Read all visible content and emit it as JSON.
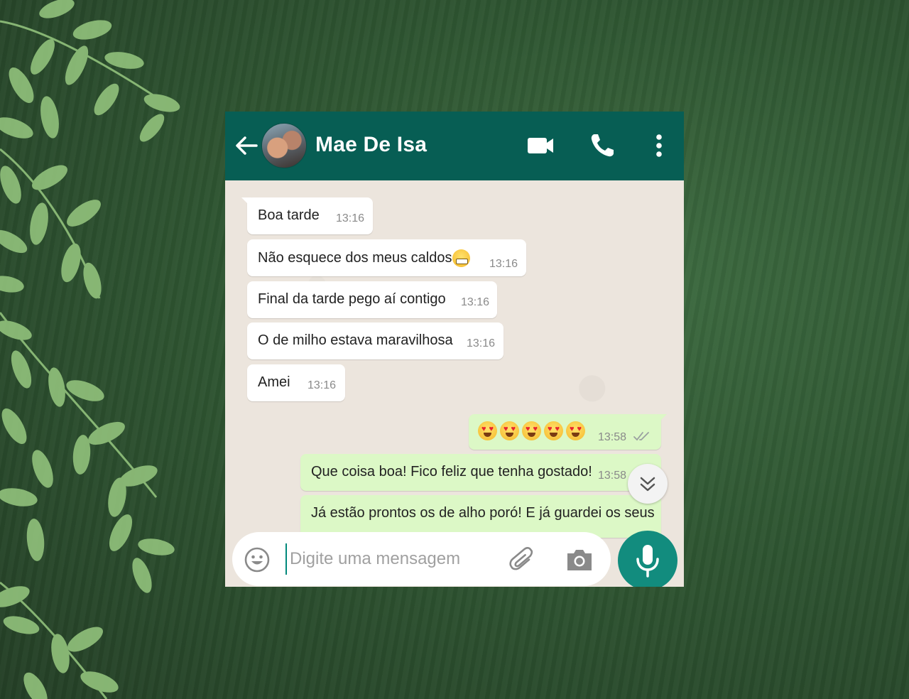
{
  "header": {
    "contact_name": "Mae De Isa"
  },
  "messages": [
    {
      "direction": "in",
      "text": "Boa tarde",
      "time": "13:16"
    },
    {
      "direction": "in",
      "text": "Não esquece dos meus caldos",
      "emoji": "grimacing-face",
      "time": "13:16"
    },
    {
      "direction": "in",
      "text": "Final da tarde pego aí contigo",
      "time": "13:16"
    },
    {
      "direction": "in",
      "text": "O de milho estava maravilhosa",
      "time": "13:16"
    },
    {
      "direction": "in",
      "text": "Amei",
      "time": "13:16"
    },
    {
      "direction": "out",
      "text": "",
      "emoji": "heart-eyes-face x5",
      "time": "13:58",
      "status": "read"
    },
    {
      "direction": "out",
      "text": "Que coisa boa! Fico feliz que tenha gostado!",
      "time": "13:58"
    },
    {
      "direction": "out",
      "text": "Já estão prontos os de alho poró! E já guardei os seus",
      "time": ""
    }
  ],
  "composer": {
    "placeholder": "Digite uma mensagem"
  },
  "colors": {
    "header": "#075e54",
    "chat_bg": "#ece5dd",
    "outgoing_bubble": "#dcf8c6",
    "incoming_bubble": "#ffffff",
    "mic_button": "#128c7e",
    "read_ticks": "#9aa0a0"
  },
  "icons": [
    "back-arrow-icon",
    "video-call-icon",
    "phone-icon",
    "more-vert-icon",
    "emoji-icon",
    "attach-icon",
    "camera-icon",
    "mic-icon",
    "double-chevron-down-icon",
    "double-check-icon"
  ]
}
